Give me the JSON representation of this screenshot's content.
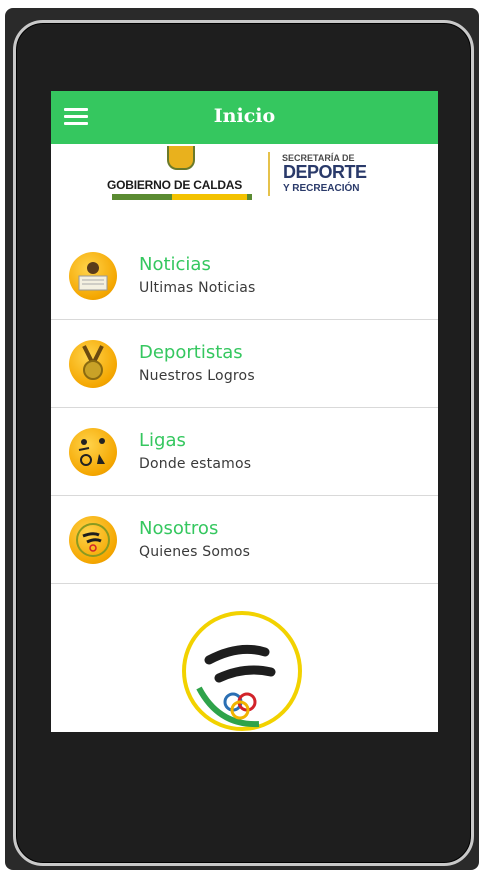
{
  "appbar": {
    "title": "Inicio",
    "menu_icon": "hamburger-icon"
  },
  "banner": {
    "gobierno": "GOBIERNO DE CALDAS",
    "secretaria_top": "SECRETARÍA DE",
    "secretaria_mid": "DEPORTE",
    "secretaria_bot": "Y RECREACIÓN"
  },
  "menu": [
    {
      "title": "Noticias",
      "subtitle": "Ultimas Noticias",
      "icon": "newspaper-icon"
    },
    {
      "title": "Deportistas",
      "subtitle": "Nuestros Logros",
      "icon": "medal-icon"
    },
    {
      "title": "Ligas",
      "subtitle": "Donde estamos",
      "icon": "sports-icon"
    },
    {
      "title": "Nosotros",
      "subtitle": "Quienes Somos",
      "icon": "logo-icon"
    }
  ],
  "colors": {
    "accent": "#35c75f",
    "icon_gold": "#f4a600"
  }
}
